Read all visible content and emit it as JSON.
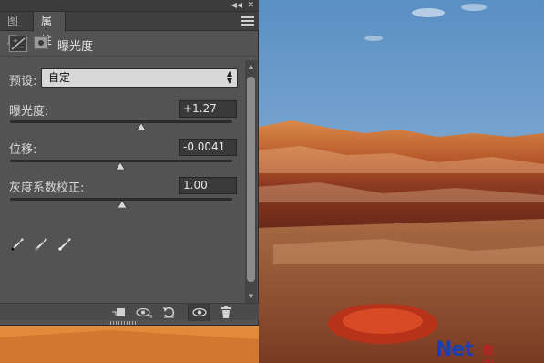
{
  "tabs": {
    "layers": "图层",
    "properties": "属性"
  },
  "panel": {
    "title": "曝光度"
  },
  "preset": {
    "label": "预设:",
    "value": "自定"
  },
  "params": [
    {
      "label": "曝光度:",
      "value": "+1.27",
      "slider_fraction": 0.59
    },
    {
      "label": "位移:",
      "value": "-0.0041",
      "slider_fraction": 0.495
    },
    {
      "label": "灰度系数校正:",
      "value": "1.00",
      "slider_fraction": 0.505
    }
  ],
  "icons": {
    "collapse": "collapse-double-arrow-icon",
    "close": "close-icon",
    "panel_menu": "panel-menu-icon",
    "adjustment": "exposure-adjustment-icon",
    "mask": "layer-mask-icon",
    "pickers": [
      "black-point-eyedropper-icon",
      "gray-point-eyedropper-icon",
      "white-point-eyedropper-icon"
    ],
    "bottom": [
      "clip-to-layer-icon",
      "view-previous-state-icon",
      "reset-icon",
      "visibility-eye-icon",
      "delete-icon"
    ]
  },
  "watermark": {
    "brand": "Net",
    "suffix": "教程"
  },
  "colors": {
    "panel_bg": "#535353",
    "tab_bar": "#3f3f3f",
    "sky": "#6a9bc9",
    "brand_blue": "#1a3fb0"
  }
}
